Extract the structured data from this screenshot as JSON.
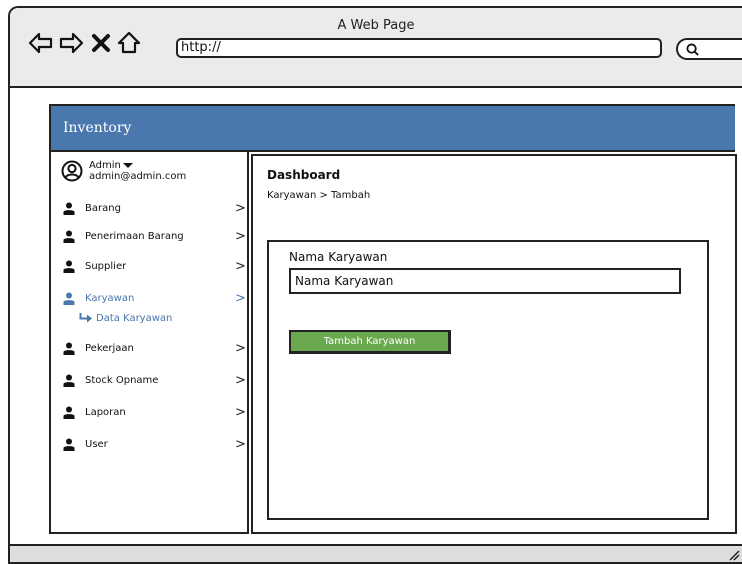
{
  "window": {
    "title": "A Web Page",
    "url": "http://"
  },
  "app": {
    "title": "Inventory"
  },
  "user": {
    "name": "Admin",
    "email": "admin@admin.com"
  },
  "sidebar": {
    "items": [
      {
        "label": "Barang",
        "chevron": ">",
        "active": false
      },
      {
        "label": "Penerimaan Barang",
        "chevron": ">",
        "active": false
      },
      {
        "label": "Supplier",
        "chevron": ">",
        "active": false
      },
      {
        "label": "Karyawan",
        "chevron": ">",
        "active": true
      },
      {
        "label": "Pekerjaan",
        "chevron": ">",
        "active": false
      },
      {
        "label": "Stock Opname",
        "chevron": ">",
        "active": false
      },
      {
        "label": "Laporan",
        "chevron": ">",
        "active": false
      },
      {
        "label": "User",
        "chevron": ">",
        "active": false
      }
    ],
    "submenu": {
      "label": "Data Karyawan"
    }
  },
  "main": {
    "heading": "Dashboard",
    "breadcrumb": "Karyawan > Tambah",
    "form": {
      "field_label": "Nama Karyawan",
      "field_value": "Nama Karyawan",
      "submit_label": "Tambah Karyawan"
    }
  },
  "colors": {
    "header": "#4a77ad",
    "button": "#6aa84f",
    "active": "#4a77ad",
    "chrome": "#ebebeb"
  },
  "icons": {
    "back": "back-arrow-icon",
    "forward": "forward-arrow-icon",
    "stop": "close-icon",
    "home": "home-icon",
    "search": "search-icon",
    "avatar": "user-avatar-icon",
    "menu": "user-icon",
    "sub": "arrow-return-icon"
  }
}
